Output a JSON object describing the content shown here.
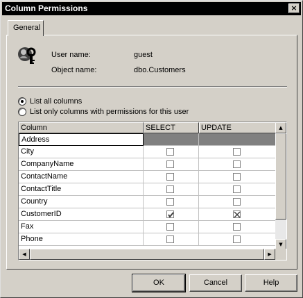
{
  "window": {
    "title": "Column Permissions",
    "close_glyph": "×"
  },
  "tabs": [
    {
      "label": "General"
    }
  ],
  "info": {
    "user_label": "User name:",
    "user_value": "guest",
    "object_label": "Object name:",
    "object_value": "dbo.Customers"
  },
  "radios": [
    {
      "label": "List all columns",
      "checked": true
    },
    {
      "label": "List only columns with permissions for this user",
      "checked": false
    }
  ],
  "grid": {
    "headers": [
      "Column",
      "SELECT",
      "UPDATE"
    ],
    "rows": [
      {
        "name": "Address",
        "select": null,
        "update": null
      },
      {
        "name": "City",
        "select": "unchecked",
        "update": "unchecked"
      },
      {
        "name": "CompanyName",
        "select": "unchecked",
        "update": "unchecked"
      },
      {
        "name": "ContactName",
        "select": "unchecked",
        "update": "unchecked"
      },
      {
        "name": "ContactTitle",
        "select": "unchecked",
        "update": "unchecked"
      },
      {
        "name": "Country",
        "select": "unchecked",
        "update": "unchecked"
      },
      {
        "name": "CustomerID",
        "select": "checked",
        "update": "denied"
      },
      {
        "name": "Fax",
        "select": "unchecked",
        "update": "unchecked"
      },
      {
        "name": "Phone",
        "select": "unchecked",
        "update": "unchecked"
      }
    ]
  },
  "buttons": {
    "ok": "OK",
    "cancel": "Cancel",
    "help": "Help"
  }
}
